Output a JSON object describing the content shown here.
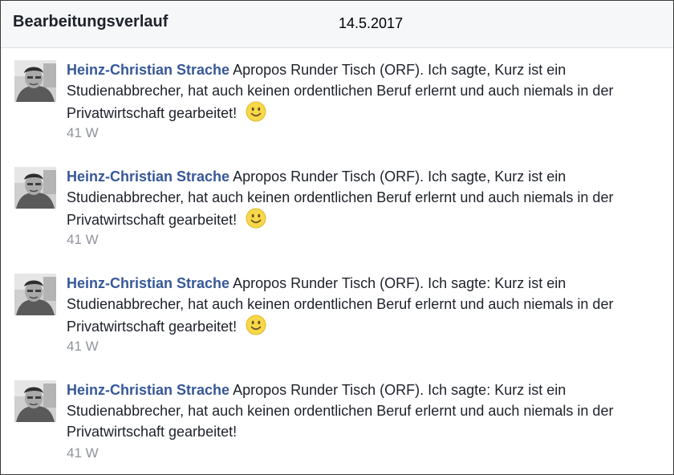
{
  "header": {
    "title": "Bearbeitungsverlauf",
    "date": "14.5.2017"
  },
  "entries": [
    {
      "author": "Heinz-Christian Strache",
      "text": "Apropos Runder Tisch (ORF). Ich sagte, Kurz ist ein Studienabbrecher, hat auch keinen ordentlichen Beruf erlernt und auch niemals in der Privatwirtschaft gearbeitet!",
      "emoji": "smiley-icon",
      "time": "41 W"
    },
    {
      "author": "Heinz-Christian Strache",
      "text": "Apropos Runder Tisch (ORF). Ich sagte, Kurz ist ein Studienabbrecher, hat auch keinen ordentlichen Beruf erlernt und auch niemals in der Privatwirtschaft gearbeitet!",
      "emoji": "smiley-icon",
      "time": "41 W"
    },
    {
      "author": "Heinz-Christian Strache",
      "text": "Apropos Runder Tisch (ORF). Ich sagte: Kurz ist ein Studienabbrecher, hat auch keinen ordentlichen Beruf erlernt und auch niemals in der Privatwirtschaft gearbeitet!",
      "emoji": "smiley-icon",
      "time": "41 W"
    },
    {
      "author": "Heinz-Christian Strache",
      "text": "Apropos Runder Tisch (ORF). Ich sagte: Kurz ist ein Studienabbrecher, hat auch keinen ordentlichen Beruf erlernt und auch niemals in der Privatwirtschaft gearbeitet!",
      "emoji": null,
      "time": "41 W"
    }
  ],
  "colors": {
    "author_link": "#365899",
    "body_text": "#1d2129",
    "timestamp": "#90949c",
    "header_bg": "#f6f7f9"
  }
}
